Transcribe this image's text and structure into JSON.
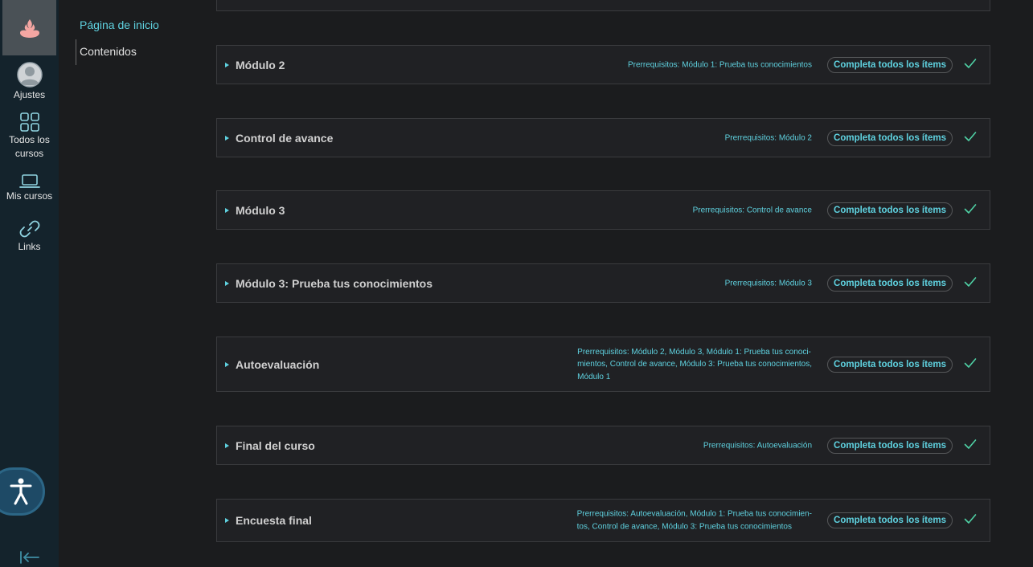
{
  "colors": {
    "accent": "#5fd2e0",
    "rail_bg": "#14232c",
    "page_bg": "#1b1c1e",
    "card_bg": "#202124",
    "success": "#4fd1a5"
  },
  "rail": {
    "logo_icon": "flame-logo-icon",
    "items": [
      {
        "label": "Ajustes",
        "icon": "user-avatar-icon"
      },
      {
        "label": "Todos los cursos",
        "icon": "grid-icon"
      },
      {
        "label": "Mis cursos",
        "icon": "laptop-icon"
      },
      {
        "label": "Links",
        "icon": "link-icon"
      }
    ],
    "accessibility_icon": "accessibility-icon",
    "collapse_icon": "collapse-left-icon"
  },
  "subnav": {
    "home": "Página de inicio",
    "current": "Contenidos"
  },
  "modules": [
    {
      "title": "Módulo 2",
      "prereq": "Prerrequisitos: Módulo 1: Prueba tus conocimientos",
      "status": "Completa todos los ítems"
    },
    {
      "title": "Control de avance",
      "prereq": "Prerrequisitos: Módulo 2",
      "status": "Completa todos los ítems"
    },
    {
      "title": "Módulo 3",
      "prereq": "Prerrequisitos: Control de avance",
      "status": "Completa todos los ítems"
    },
    {
      "title": "Módulo 3: Prueba tus conocimientos",
      "prereq": "Prerrequisitos: Módulo 3",
      "status": "Completa todos los ítems"
    },
    {
      "title": "Autoevaluación",
      "prereq_lines": [
        "Prerrequisitos: Módulo 2, Módulo 3, Módulo 1: Prueba tus conoci-",
        "mientos, Control de avance, Módulo 3: Prueba tus conocimientos,",
        "Módulo 1"
      ],
      "status": "Completa todos los ítems"
    },
    {
      "title": "Final del curso",
      "prereq": "Prerrequisitos: Autoevaluación",
      "status": "Completa todos los ítems"
    },
    {
      "title": "Encuesta final",
      "prereq_lines": [
        "Prerrequisitos: Autoevaluación, Módulo 1: Prueba tus conocimien-",
        "tos, Control de avance, Módulo 3: Prueba tus conocimientos"
      ],
      "status": "Completa todos los ítems"
    }
  ]
}
